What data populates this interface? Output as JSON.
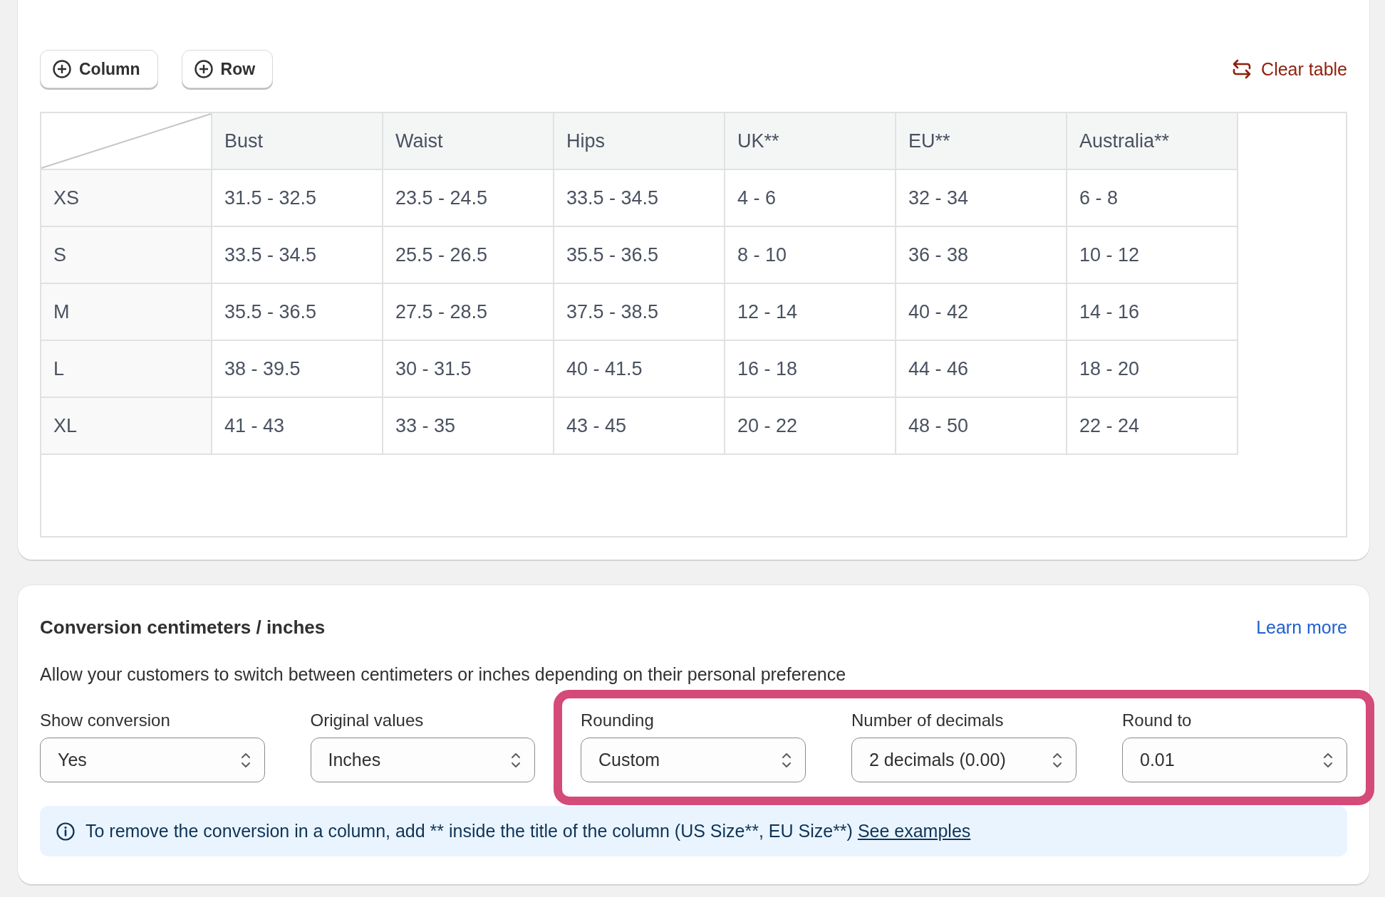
{
  "toolbar": {
    "buttons": [
      {
        "label": "Column"
      },
      {
        "label": "Row"
      }
    ],
    "clear_table": "Clear table"
  },
  "table": {
    "columns": [
      "Bust",
      "Waist",
      "Hips",
      "UK**",
      "EU**",
      "Australia**"
    ],
    "rows": [
      {
        "size": "XS",
        "cells": [
          "31.5 - 32.5",
          "23.5 - 24.5",
          "33.5 - 34.5",
          "4 - 6",
          "32 - 34",
          "6 - 8"
        ]
      },
      {
        "size": "S",
        "cells": [
          "33.5 - 34.5",
          "25.5 - 26.5",
          "35.5 - 36.5",
          "8 - 10",
          "36 - 38",
          "10 - 12"
        ]
      },
      {
        "size": "M",
        "cells": [
          "35.5 - 36.5",
          "27.5 - 28.5",
          "37.5 - 38.5",
          "12 - 14",
          "40 - 42",
          "14 - 16"
        ]
      },
      {
        "size": "L",
        "cells": [
          "38 - 39.5",
          "30 - 31.5",
          "40 - 41.5",
          "16 - 18",
          "44 - 46",
          "18 - 20"
        ]
      },
      {
        "size": "XL",
        "cells": [
          "41 - 43",
          "33 - 35",
          "43 - 45",
          "20 - 22",
          "48 - 50",
          "22 - 24"
        ]
      }
    ]
  },
  "conversion": {
    "title": "Conversion centimeters / inches",
    "learn_more": "Learn more",
    "description": "Allow your customers to switch between centimeters or inches depending on their personal preference",
    "fields": [
      {
        "label": "Show conversion",
        "value": "Yes",
        "highlighted": false
      },
      {
        "label": "Original values",
        "value": "Inches",
        "highlighted": false
      },
      {
        "label": "Rounding",
        "value": "Custom",
        "highlighted": true
      },
      {
        "label": "Number of decimals",
        "value": "2 decimals (0.00)",
        "highlighted": true
      },
      {
        "label": "Round to",
        "value": "0.01",
        "highlighted": true
      }
    ],
    "info": {
      "text": "To remove the conversion in a column, add ** inside the title of the column (US Size**, EU Size**)",
      "link": "See examples"
    }
  }
}
